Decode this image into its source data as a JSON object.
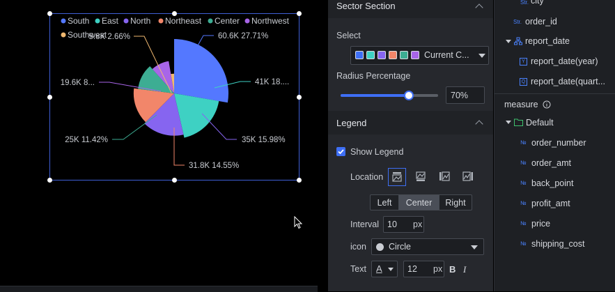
{
  "chart_data": {
    "type": "pie",
    "subtype": "rose",
    "legend": [
      "South",
      "East",
      "North",
      "Northeast",
      "Center",
      "Northwest",
      "Southwest"
    ],
    "legend_position": "top-center",
    "series": [
      {
        "name": "South",
        "value": 60600,
        "label": "60.6K 27.71%",
        "color": "#5478ff"
      },
      {
        "name": "East",
        "value": 41000,
        "label": "41K 18....",
        "color": "#3ed1c3"
      },
      {
        "name": "North",
        "value": 35000,
        "label": "35K 15.98%",
        "color": "#8665f0"
      },
      {
        "name": "Northeast",
        "value": 31800,
        "label": "31.8K 14.55%",
        "color": "#f2866a"
      },
      {
        "name": "Center",
        "value": 25000,
        "label": "25K 11.42%",
        "color": "#3dad93"
      },
      {
        "name": "Northwest",
        "value": 19600,
        "label": "19.6K 8...",
        "color": "#a865e8"
      },
      {
        "name": "Southwest",
        "value": 5800,
        "label": "5.8K 2.66%",
        "color": "#f0b870"
      }
    ],
    "labels": {
      "South": "60.6K 27.71%",
      "East": "41K 18....",
      "North": "35K 15.98%",
      "Northeast": "31.8K 14.55%",
      "Center": "25K 11.42%",
      "Northwest": "19.6K 8...",
      "Southwest": "5.8K 2.66%"
    }
  },
  "panel": {
    "sector_section": "Sector Section",
    "select_label": "Select",
    "select_value": "Current C...",
    "palette": [
      "#3e6ff5",
      "#3ed1c3",
      "#8665f0",
      "#f2866a",
      "#3dad93",
      "#a865e8"
    ],
    "radius_label": "Radius Percentage",
    "radius_value": "70%",
    "radius_percent": 70,
    "legend_section": "Legend",
    "show_legend": "Show Legend",
    "location_label": "Location",
    "align_left": "Left",
    "align_center": "Center",
    "align_right": "Right",
    "interval_label": "Interval",
    "interval_value": "10",
    "interval_unit": "px",
    "icon_label": "icon",
    "icon_value": "Circle",
    "text_label": "Text",
    "text_size": "12",
    "text_unit": "px",
    "text_color_letter": "A",
    "bold": "B",
    "italic": "I"
  },
  "fields": {
    "city": "city",
    "order_id": "order_id",
    "report_date": "report_date",
    "report_date_year": "report_date(year)",
    "report_date_quarter": "report_date(quart...",
    "measure": "measure",
    "default_folder": "Default",
    "measures": [
      "order_number",
      "order_amt",
      "back_point",
      "profit_amt",
      "price",
      "shipping_cost"
    ],
    "str_tag": "Str.",
    "num_tag": "№",
    "year_tag": "Y",
    "quarter_tag": "Q"
  },
  "colors": {
    "accent": "#3e6ff5",
    "selection": "#3f5fd6",
    "panel_bg": "#26282d",
    "section_bg": "#202226"
  }
}
